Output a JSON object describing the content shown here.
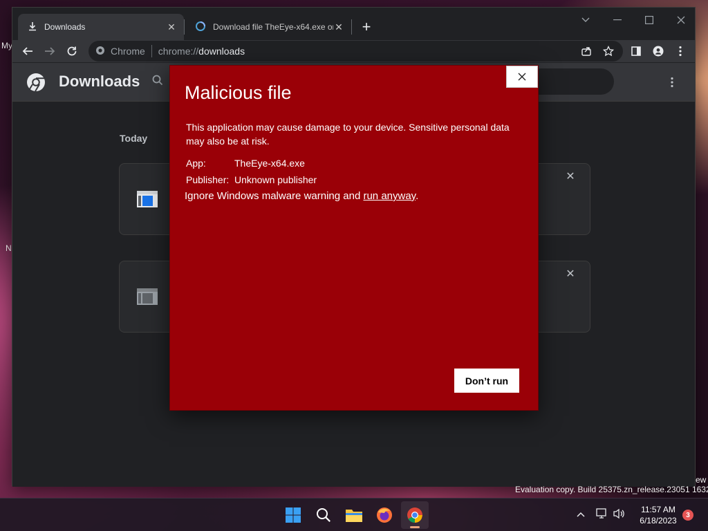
{
  "desktop": {
    "fragments": [
      "My",
      "N"
    ],
    "watermark": "Evaluation copy. Build 25375.zn_release.23051 1632",
    "watermark_frag": "ew"
  },
  "browser": {
    "tabs": [
      {
        "label": "Downloads",
        "icon": "download-icon",
        "active": true
      },
      {
        "label": "Download file TheEye-x64.exe or",
        "icon": "loading-icon",
        "active": false
      }
    ],
    "new_tab_label": "+",
    "omnibox": {
      "site_label": "Chrome",
      "scheme": "chrome://",
      "host": "downloads"
    }
  },
  "downloads_page": {
    "title": "Downloads",
    "section_label": "Today",
    "cards": [
      {
        "icon": "app-file-icon",
        "color": "#1a73e8"
      },
      {
        "icon": "app-file-icon",
        "color": "#9aa0a6"
      }
    ]
  },
  "dialog": {
    "title": "Malicious file",
    "message": "This application may cause damage to your device. Sensitive personal data may also be at risk.",
    "app_label": "App:",
    "app_value": "TheEye-x64.exe",
    "publisher_label": "Publisher:",
    "publisher_value": "Unknown publisher",
    "ignore_text": "Ignore Windows malware warning and ",
    "run_anyway_link": "run anyway",
    "period": ".",
    "dont_run_label": "Don’t run",
    "background_color": "#9a0007"
  },
  "taskbar": {
    "apps": [
      "windows-start-icon",
      "search-icon",
      "file-explorer-icon",
      "firefox-icon",
      "chrome-icon"
    ],
    "active_app": "chrome-icon",
    "time": "11:57 AM",
    "date": "6/18/2023",
    "notification_count": "3"
  }
}
